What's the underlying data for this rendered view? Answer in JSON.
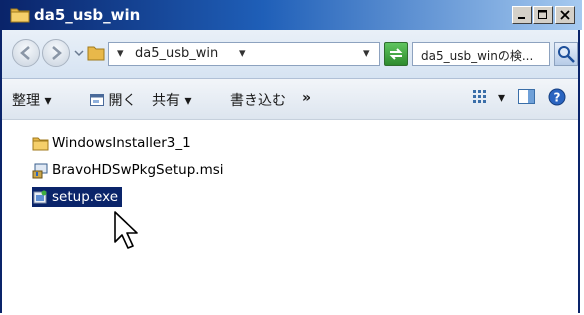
{
  "window": {
    "title": "da5_usb_win"
  },
  "title_buttons": {
    "minimize": "_",
    "maximize": "□",
    "close": "✕"
  },
  "address": {
    "path_segment": "da5_usb_win",
    "search_placeholder": "da5_usb_winの検..."
  },
  "toolbar": {
    "organize": "整理",
    "open": "開く",
    "share": "共有",
    "burn": "書き込む",
    "more": "»"
  },
  "files": [
    {
      "name": "WindowsInstaller3_1",
      "icon": "folder-icon",
      "selected": false
    },
    {
      "name": "BravoHDSwPkgSetup.msi",
      "icon": "msi-installer-icon",
      "selected": false
    },
    {
      "name": "setup.exe",
      "icon": "setup-exe-icon",
      "selected": true
    }
  ],
  "colors": {
    "selection": "#0a246a",
    "titlebar": "#0a246a",
    "accent": "#1f5fb8"
  }
}
